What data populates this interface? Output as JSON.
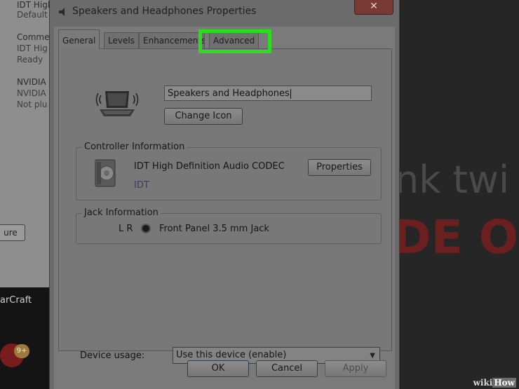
{
  "background": {
    "left_items": [
      {
        "line1": "IDT High",
        "line2": "Default"
      },
      {
        "line1": "Comme",
        "line2": "IDT Hig",
        "line3": "Ready"
      },
      {
        "line1": "NVIDIA",
        "line2": "NVIDIA",
        "line3": "Not plu"
      }
    ],
    "configure_label": "ure",
    "app_label": "arCraft",
    "badge_count": "9+",
    "right_text_1": "nk twi",
    "right_text_2": "DE O",
    "watermark_wiki": "wiki",
    "watermark_how": "How"
  },
  "dialog": {
    "title": "Speakers and Headphones Properties",
    "close_label": "✕",
    "tabs": [
      {
        "label": "General"
      },
      {
        "label": "Levels"
      },
      {
        "label": "Enhancements"
      },
      {
        "label": "Advanced"
      }
    ],
    "device_name": "Speakers and Headphones",
    "change_icon_label": "Change Icon",
    "controller": {
      "group_label": "Controller Information",
      "name": "IDT High Definition Audio CODEC",
      "vendor": "IDT",
      "properties_label": "Properties"
    },
    "jack": {
      "group_label": "Jack Information",
      "channels": "L R",
      "description": "Front Panel 3.5 mm Jack"
    },
    "device_usage": {
      "label": "Device usage:",
      "selected": "Use this device (enable)"
    },
    "buttons": {
      "ok": "OK",
      "cancel": "Cancel",
      "apply": "Apply"
    }
  },
  "colors": {
    "highlight": "#2bdd1f",
    "close_button": "#7a3a34"
  }
}
